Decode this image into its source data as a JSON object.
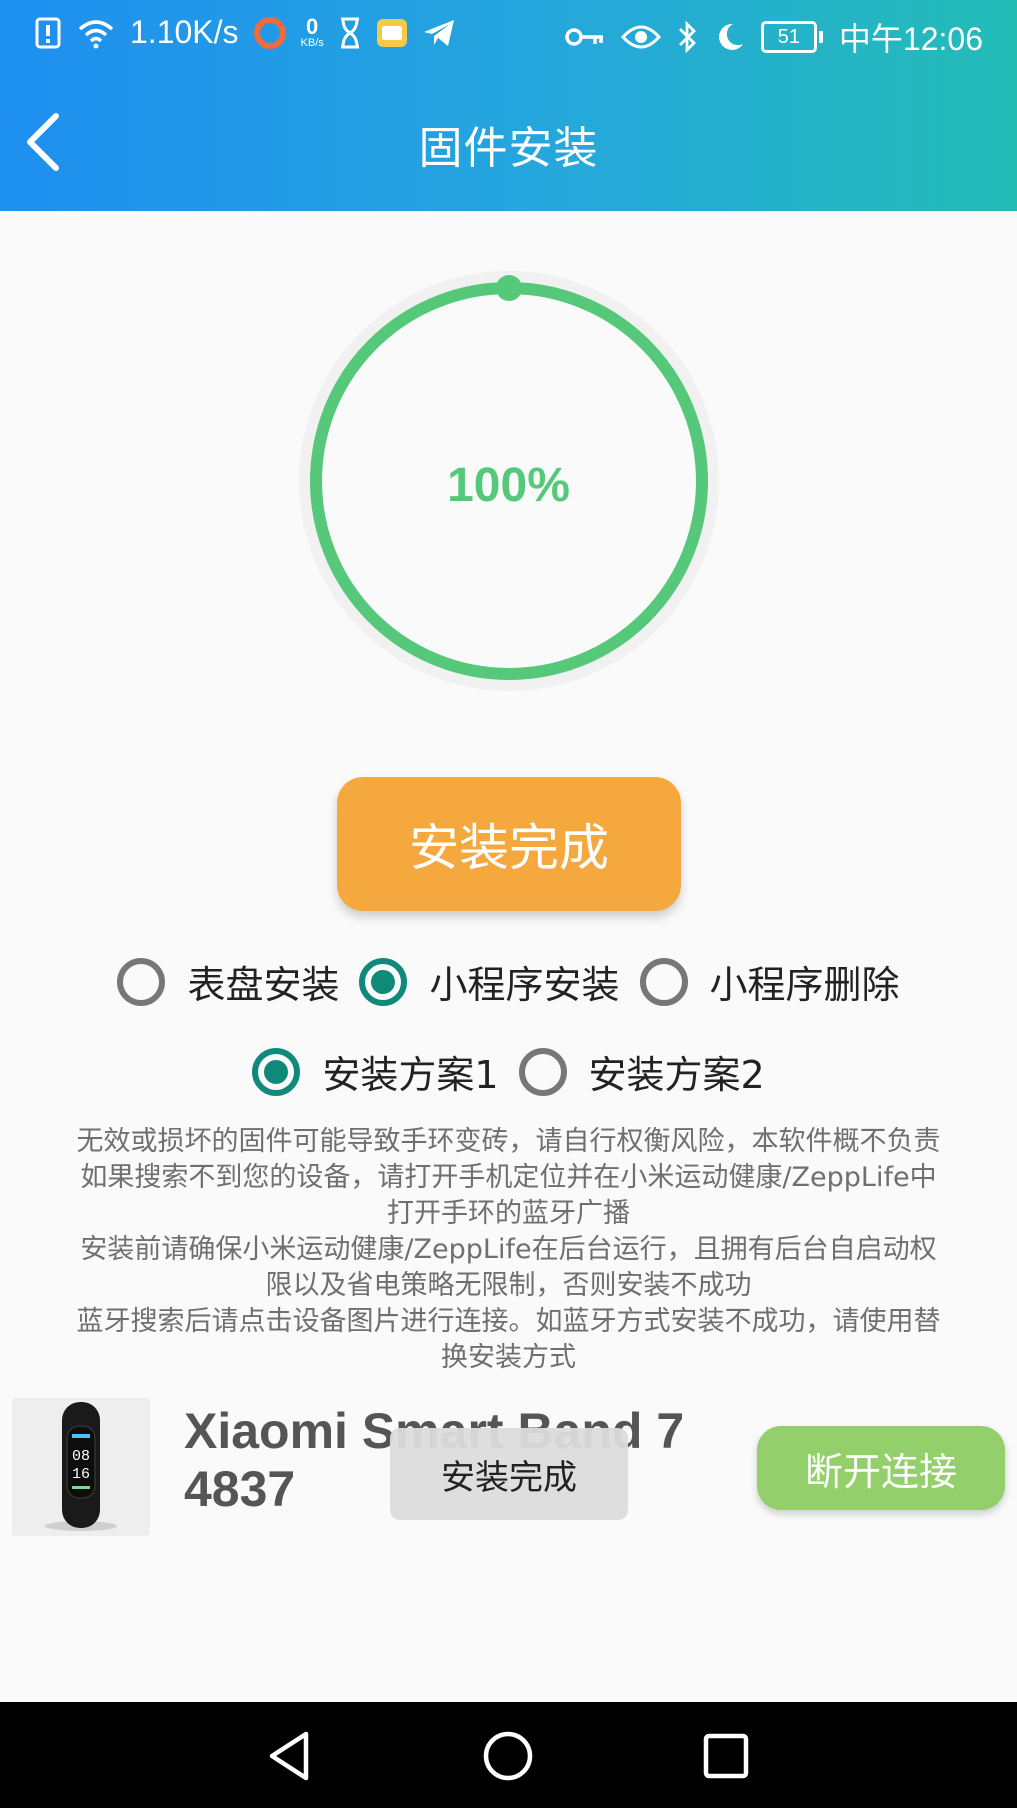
{
  "status_bar": {
    "speed": "1.10K/s",
    "speed_badge_value": "0",
    "speed_badge_unit": "KB/s",
    "battery": "51",
    "time": "中午12:06",
    "icons": [
      "alert-icon",
      "wifi-icon",
      "speed-badge",
      "record-icon",
      "hourglass-icon",
      "folder-app-icon",
      "telegram-icon",
      "key-icon",
      "eye-icon",
      "bluetooth-icon",
      "moon-icon",
      "battery-icon"
    ]
  },
  "header": {
    "title": "固件安装"
  },
  "progress": {
    "percent_label": "100%",
    "value": 1.0,
    "color": "#56c87a"
  },
  "main_button": {
    "label": "安装完成",
    "color": "#f5a83e"
  },
  "install_types": [
    {
      "label": "表盘安装",
      "selected": false
    },
    {
      "label": "小程序安装",
      "selected": true
    },
    {
      "label": "小程序删除",
      "selected": false
    }
  ],
  "install_plans": [
    {
      "label": "安装方案1",
      "selected": true
    },
    {
      "label": "安装方案2",
      "selected": false
    }
  ],
  "notes": [
    "无效或损坏的固件可能导致手环变砖，请自行权衡风险，本软件概不负责",
    "如果搜索不到您的设备，请打开手机定位并在小米运动健康/ZeppLife中",
    "打开手环的蓝牙广播",
    "安装前请确保小米运动健康/ZeppLife在后台运行，且拥有后台自启动权",
    "限以及省电策略无限制，否则安装不成功",
    "蓝牙搜索后请点击设备图片进行连接。如蓝牙方式安装不成功，请使用替",
    "换安装方式"
  ],
  "device": {
    "name_line1": "Xiaomi Smart Band 7",
    "name_line2": "4837",
    "screen_time_hours": "08",
    "screen_time_minutes": "16"
  },
  "disconnect_button": {
    "label": "断开连接",
    "color": "#93cf6a"
  },
  "toast": {
    "text": "安装完成"
  },
  "nav_bar": {
    "back": "back-nav-icon",
    "home": "home-nav-icon",
    "recents": "recents-nav-icon"
  }
}
